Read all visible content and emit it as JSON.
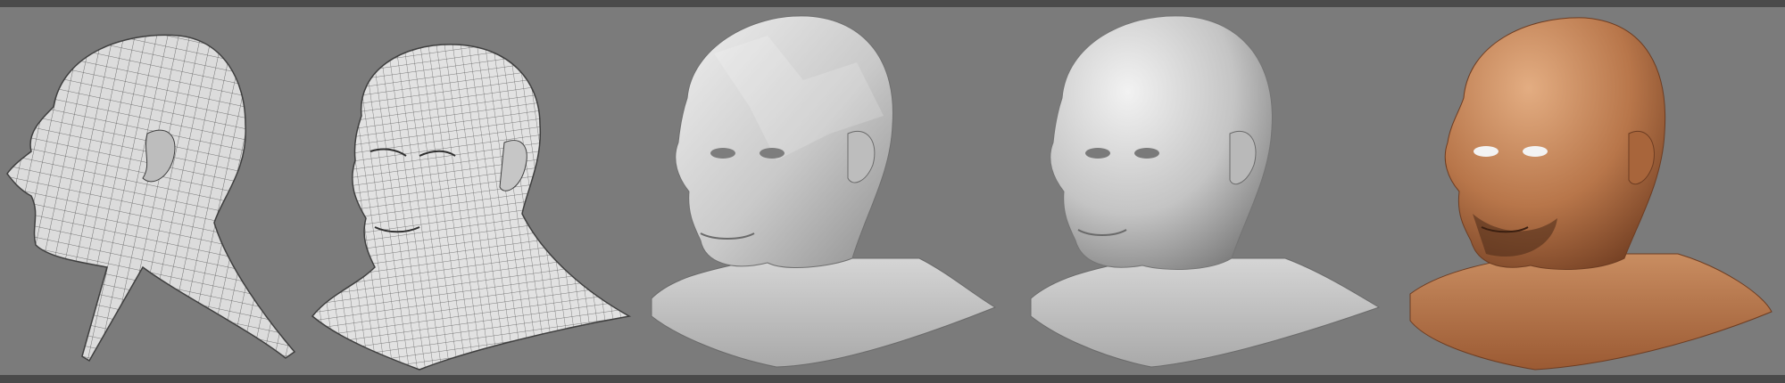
{
  "scene": {
    "background_color": "#7b7b7b",
    "frame_color": "#4a4a4a",
    "stages": [
      {
        "name": "low-poly-wireframe-profile",
        "render": "wireframe"
      },
      {
        "name": "medium-wireframe-three-quarter",
        "render": "wireframe"
      },
      {
        "name": "faceted-grey-shaded",
        "render": "flat-shaded"
      },
      {
        "name": "smooth-sculpted-grey",
        "render": "smooth-shaded"
      },
      {
        "name": "textured-skin-final",
        "render": "textured"
      }
    ],
    "colors": {
      "wire_fill": "#d9d9d9",
      "wire_line": "#5a5a5a",
      "grey_light": "#e6e6e6",
      "grey_dark": "#8e8e8e",
      "skin_light": "#d79d73",
      "skin_dark": "#7a4426"
    }
  }
}
